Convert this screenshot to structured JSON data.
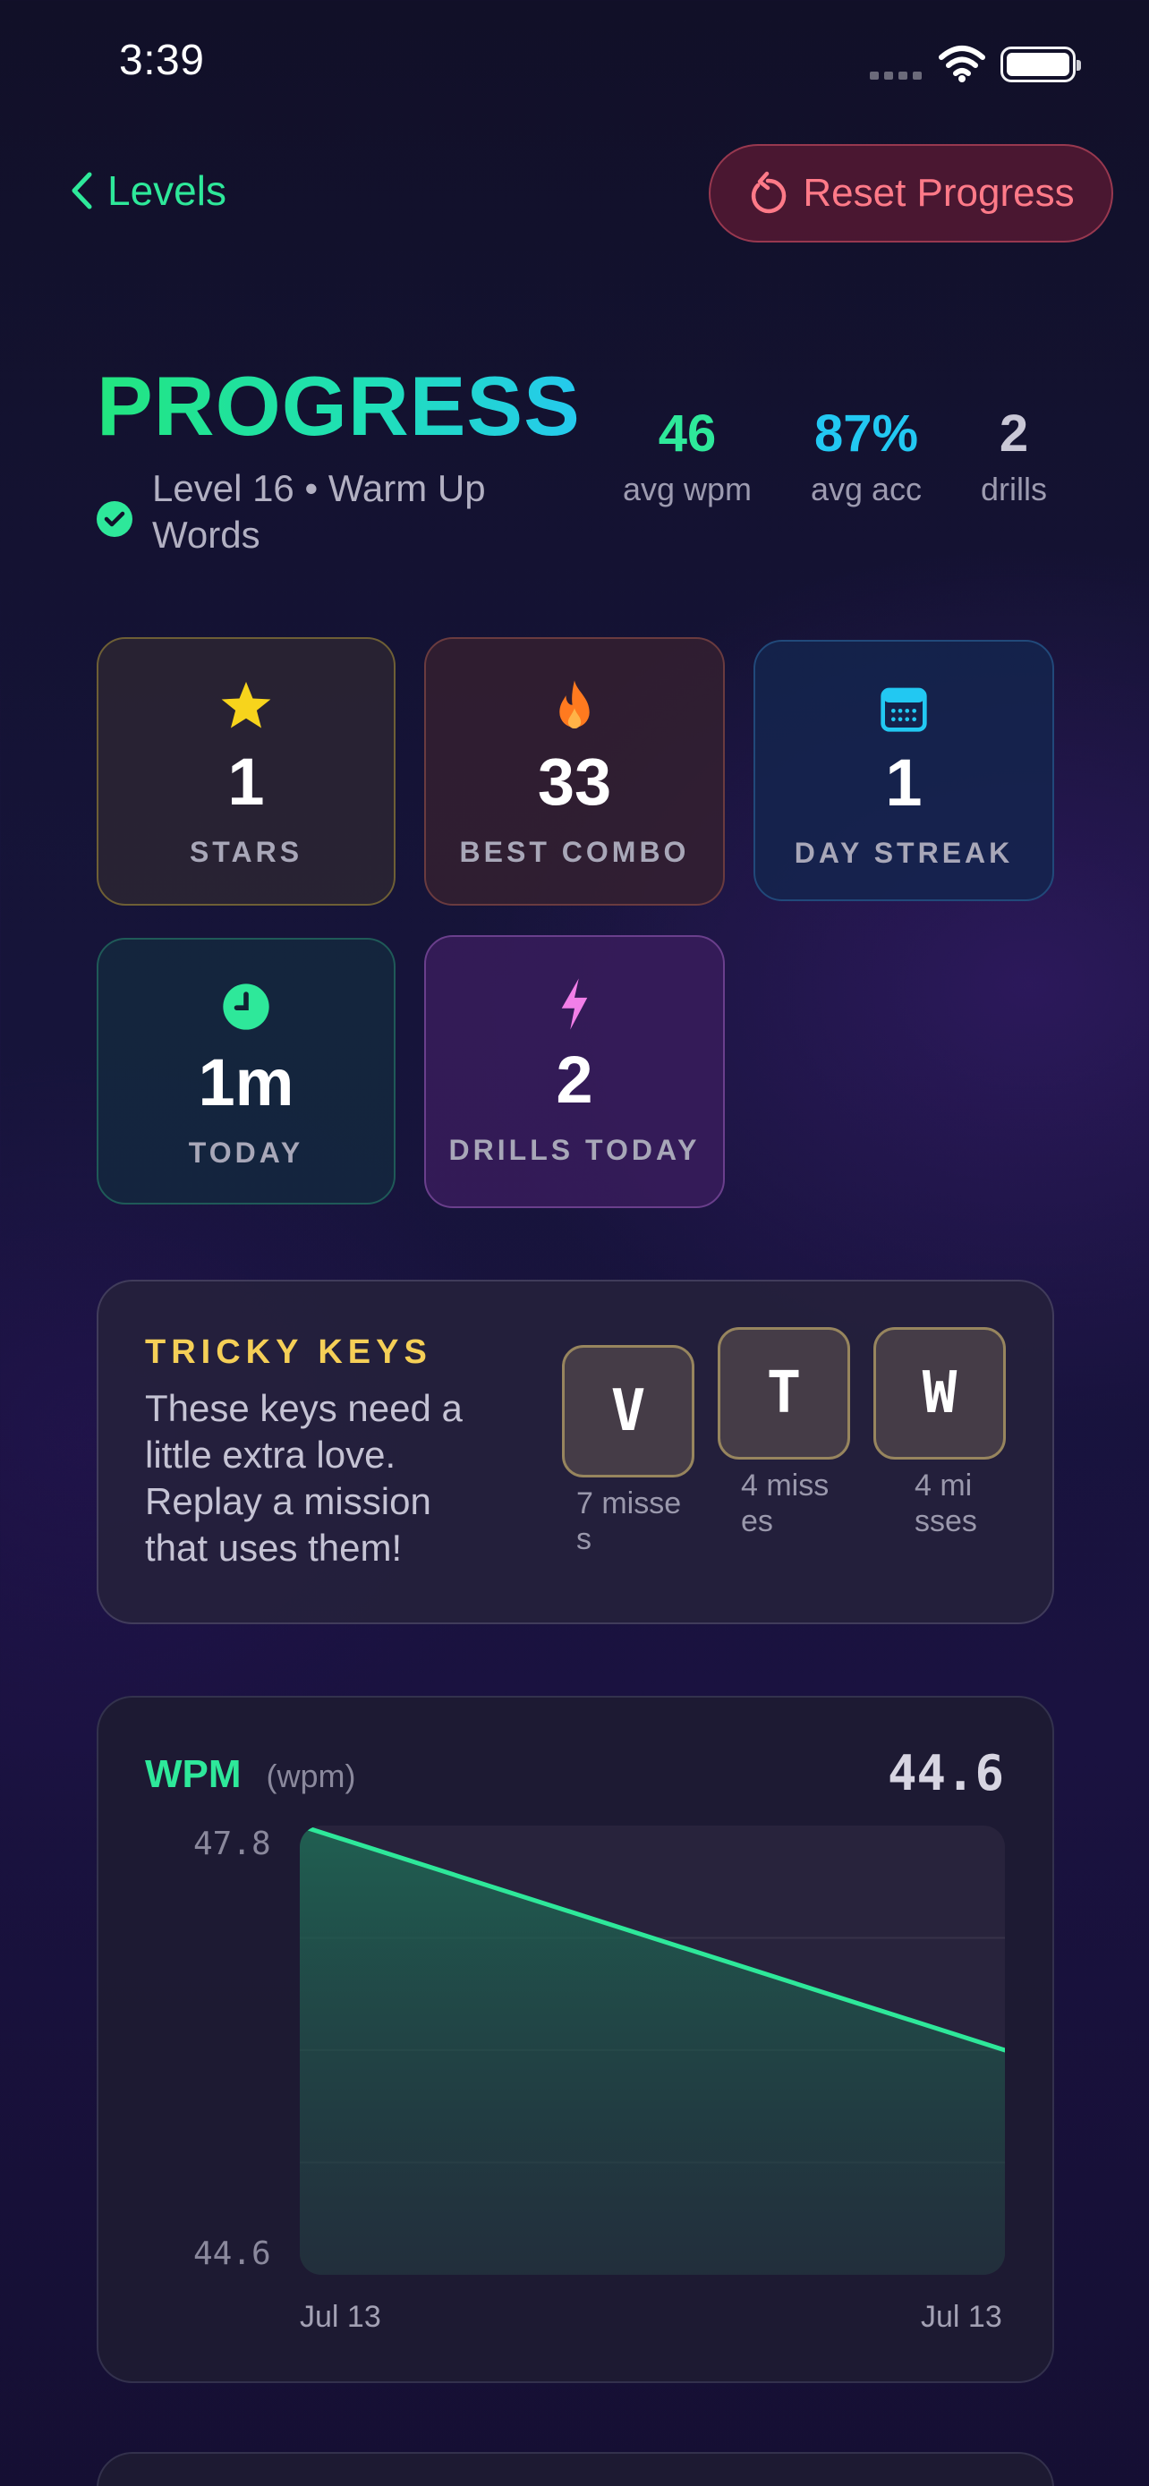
{
  "status_bar": {
    "time": "3:39"
  },
  "nav": {
    "back_label": "Levels",
    "reset_label": "Reset Progress"
  },
  "header": {
    "title": "PROGRESS",
    "level_text": "Level 16 • Warm Up Words",
    "stats": [
      {
        "value": "46",
        "label": "avg wpm",
        "color": "#2ee89a"
      },
      {
        "value": "87%",
        "label": "avg acc",
        "color": "#22c8f2"
      },
      {
        "value": "2",
        "label": "drills",
        "color": "#c9c7d6"
      }
    ]
  },
  "tiles": [
    {
      "icon": "star-icon",
      "value": "1",
      "label": "STARS"
    },
    {
      "icon": "flame-icon",
      "value": "33",
      "label": "BEST COMBO"
    },
    {
      "icon": "calendar-icon",
      "value": "1",
      "label": "DAY STREAK"
    },
    {
      "icon": "clock-icon",
      "value": "1m",
      "label": "TODAY"
    },
    {
      "icon": "lightning-icon",
      "value": "2",
      "label": "DRILLS TODAY"
    }
  ],
  "tricky_keys": {
    "heading": "TRICKY KEYS",
    "description": "These keys need a little extra love. Replay a mission that uses them!",
    "keys": [
      {
        "key": "V",
        "misses": "7 misses"
      },
      {
        "key": "T",
        "misses": "4 misses"
      },
      {
        "key": "W",
        "misses": "4 misses"
      }
    ]
  },
  "wpm_card": {
    "title": "WPM",
    "unit": "(wpm)",
    "current_value": "44.6",
    "y_max_label": "47.8",
    "y_min_label": "44.6",
    "x_start_label": "Jul 13",
    "x_end_label": "Jul 13",
    "line_color": "#2ee89a"
  },
  "chart_data": {
    "type": "area",
    "x": [
      "Jul 13",
      "Jul 13"
    ],
    "values": [
      47.8,
      46.2
    ],
    "title": "WPM",
    "ylabel": "(wpm)",
    "ylim": [
      44.6,
      47.8
    ],
    "grid": true
  }
}
